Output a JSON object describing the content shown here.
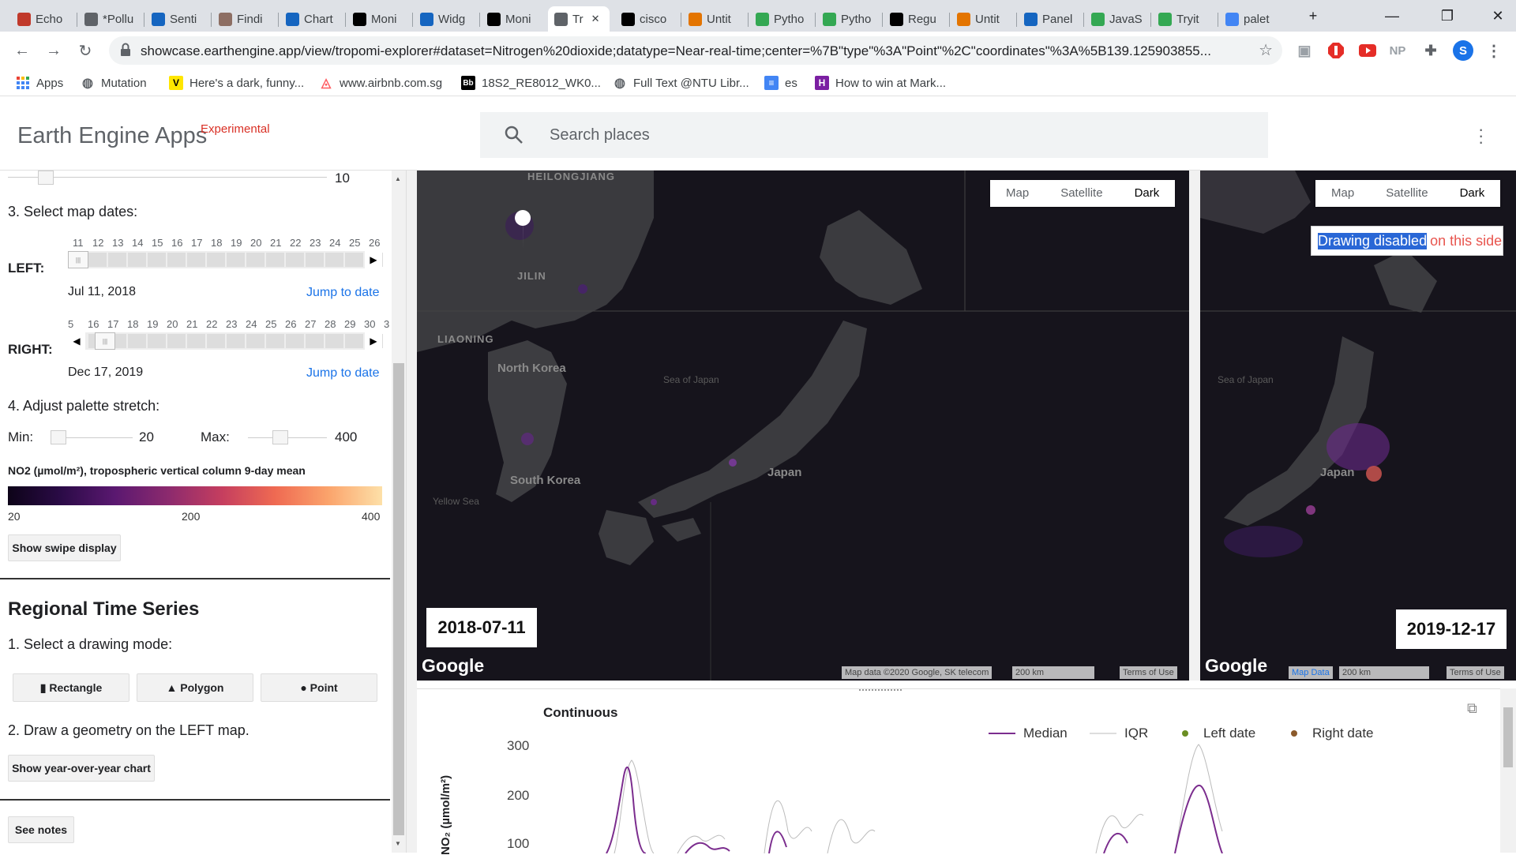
{
  "browser": {
    "tabs": [
      {
        "title": "Echo",
        "icon_color": "#c0392b"
      },
      {
        "title": "*Pollu",
        "icon_color": "#5f6368"
      },
      {
        "title": "Senti",
        "icon_color": "#1565c0"
      },
      {
        "title": "Findi",
        "icon_color": "#8d6e63"
      },
      {
        "title": "Chart",
        "icon_color": "#1565c0"
      },
      {
        "title": "Moni",
        "icon_color": "#000000"
      },
      {
        "title": "Widg",
        "icon_color": "#1565c0"
      },
      {
        "title": "Moni",
        "icon_color": "#000000"
      },
      {
        "title": "Tr",
        "icon_color": "#5f6368"
      },
      {
        "title": "cisco",
        "icon_color": "#000000"
      },
      {
        "title": "Untit",
        "icon_color": "#e37400"
      },
      {
        "title": "Pytho",
        "icon_color": "#34a853"
      },
      {
        "title": "Pytho",
        "icon_color": "#34a853"
      },
      {
        "title": "Regu",
        "icon_color": "#000000"
      },
      {
        "title": "Untit",
        "icon_color": "#e37400"
      },
      {
        "title": "Panel",
        "icon_color": "#1565c0"
      },
      {
        "title": "JavaS",
        "icon_color": "#34a853"
      },
      {
        "title": "Tryit",
        "icon_color": "#34a853"
      },
      {
        "title": "palet",
        "icon_color": "#4285f4"
      }
    ],
    "url": "showcase.earthengine.app/view/tropomi-explorer#dataset=Nitrogen%20dioxide;datatype=Near-real-time;center=%7B\"type\"%3A\"Point\"%2C\"coordinates\"%3A%5B139.125903855...",
    "bookmarks": [
      {
        "label": "Apps"
      },
      {
        "label": "Mutation"
      },
      {
        "label": "Here's a dark, funny..."
      },
      {
        "label": "www.airbnb.com.sg"
      },
      {
        "label": "18S2_RE8012_WK0..."
      },
      {
        "label": "Full Text @NTU Libr..."
      },
      {
        "label": "es"
      },
      {
        "label": "How to win at Mark..."
      }
    ],
    "extensions": [
      "NP",
      "S"
    ]
  },
  "app": {
    "title": "Earth Engine Apps",
    "badge": "Experimental",
    "search_placeholder": "Search places"
  },
  "panel": {
    "top_slider_value": "10",
    "step3_label": "3. Select map dates:",
    "left": {
      "label": "LEFT:",
      "day_ticks": [
        "11",
        "12",
        "13",
        "14",
        "15",
        "16",
        "17",
        "18",
        "19",
        "20",
        "21",
        "22",
        "23",
        "24",
        "25",
        "26"
      ],
      "date": "Jul 11, 2018",
      "jump": "Jump to date"
    },
    "right": {
      "label": "RIGHT:",
      "day_ticks": [
        "5",
        "16",
        "17",
        "18",
        "19",
        "20",
        "21",
        "22",
        "23",
        "24",
        "25",
        "26",
        "27",
        "28",
        "29",
        "30",
        "3"
      ],
      "date": "Dec 17, 2019",
      "jump": "Jump to date"
    },
    "step4_label": "4. Adjust palette stretch:",
    "min_label": "Min:",
    "min_value": "20",
    "max_label": "Max:",
    "max_value": "400",
    "palette_title": "NO2 (µmol/m²), tropospheric vertical column 9-day mean",
    "palette_ticks": [
      "20",
      "200",
      "400"
    ],
    "swipe_button": "Show swipe display",
    "section_title": "Regional Time Series",
    "step1_label": "1. Select a drawing mode:",
    "draw_modes": [
      {
        "label": "▮ Rectangle"
      },
      {
        "label": "▲ Polygon"
      },
      {
        "label": "● Point"
      }
    ],
    "step2_label": "2. Draw a geometry on the LEFT map.",
    "yoy_button": "Show year-over-year chart",
    "notes_button": "See notes"
  },
  "left_map": {
    "map_types": [
      "Map",
      "Satellite",
      "Dark"
    ],
    "selected_type": "Dark",
    "date": "2018-07-11",
    "labels": [
      "HEILONGJIANG",
      "JILIN",
      "LIAONING",
      "North Korea",
      "South Korea",
      "Japan",
      "Sea of Japan",
      "Yellow Sea"
    ],
    "google": "Google",
    "attribution": "Map data ©2020 Google, SK telecom",
    "scale": "200 km",
    "terms": "Terms of Use"
  },
  "right_map": {
    "map_types": [
      "Map",
      "Satellite",
      "Dark"
    ],
    "selected_type": "Dark",
    "date": "2019-12-17",
    "drawing_highlight": "Drawing disabled",
    "drawing_rest": "on this side",
    "labels": [
      "Sea of Japan",
      "Japan"
    ],
    "google": "Google",
    "attribution": "Map Data",
    "scale": "200 km",
    "terms": "Terms of Use"
  },
  "chart_data": {
    "type": "line",
    "title": "Continuous",
    "ylabel": "NO₂ (µmol/m²)",
    "y_ticks": [
      "300",
      "200",
      "100"
    ],
    "series": [
      {
        "name": "Median",
        "color": "#7b2d8e"
      },
      {
        "name": "IQR",
        "color": "#bbbbbb"
      },
      {
        "name": "Left date",
        "color": "#6b8e23"
      },
      {
        "name": "Right date",
        "color": "#8b5a2b"
      }
    ]
  }
}
